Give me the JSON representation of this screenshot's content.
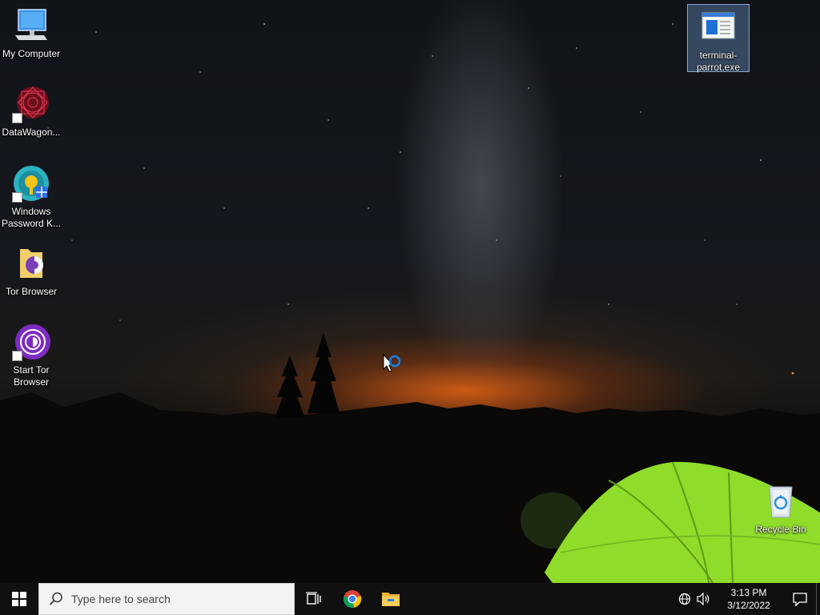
{
  "desktop": {
    "icons": [
      {
        "label": "My Computer",
        "icon": "computer-icon"
      },
      {
        "label": "DataWagon...",
        "icon": "datawagon-icon"
      },
      {
        "label": "Windows Password K...",
        "icon": "windows-password-key-icon"
      },
      {
        "label": "Tor Browser",
        "icon": "tor-browser-folder-icon"
      },
      {
        "label": "Start Tor Browser",
        "icon": "tor-browser-icon"
      },
      {
        "label": "terminal-parrot.exe",
        "icon": "exe-file-icon"
      },
      {
        "label": "Recycle Bin",
        "icon": "recycle-bin-icon"
      }
    ]
  },
  "taskbar": {
    "search_placeholder": "Type here to search",
    "pinned": [
      "task-view-icon",
      "chrome-icon",
      "file-explorer-icon"
    ],
    "clock": {
      "time": "3:13 PM",
      "date": "3/12/2022"
    }
  },
  "colors": {
    "taskbar": "#101011",
    "selection": "#7aaae6",
    "tent": "#8fdc2a",
    "horizon_glow": "#ff6e14"
  }
}
